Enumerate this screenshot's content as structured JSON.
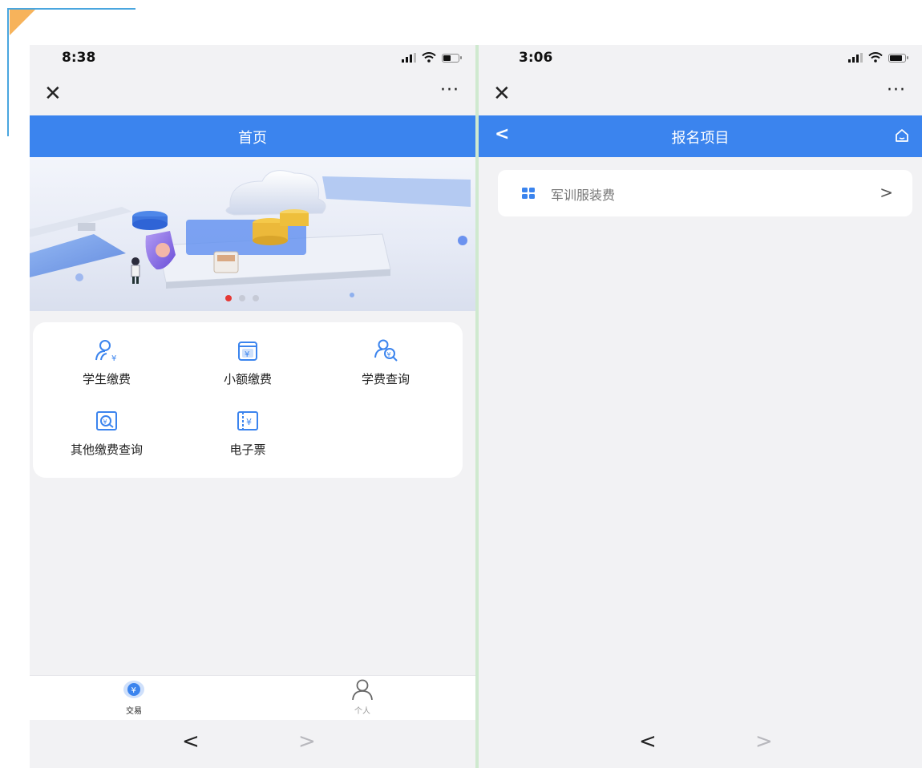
{
  "left_screen": {
    "status": {
      "time": "8:38"
    },
    "nav": {
      "close": "✕",
      "more": "···"
    },
    "header": {
      "title": "首页"
    },
    "carousel": {
      "slides": 3,
      "active_index": 0
    },
    "menu": [
      {
        "label": "学生缴费",
        "icon": "student-payment-icon"
      },
      {
        "label": "小额缴费",
        "icon": "small-payment-icon"
      },
      {
        "label": "学费查询",
        "icon": "tuition-query-icon"
      },
      {
        "label": "其他缴费查询",
        "icon": "other-payment-query-icon"
      },
      {
        "label": "电子票",
        "icon": "e-ticket-icon"
      }
    ],
    "tabbar": [
      {
        "label": "交易",
        "icon": "transaction-icon",
        "active": true
      },
      {
        "label": "个人",
        "icon": "person-icon",
        "active": false
      }
    ],
    "browser_nav": {
      "back": "<",
      "forward": ">"
    }
  },
  "right_screen": {
    "status": {
      "time": "3:06"
    },
    "nav": {
      "close": "✕",
      "more": "···"
    },
    "header": {
      "title": "报名项目",
      "back": "<"
    },
    "items": [
      {
        "label": "军训服装费",
        "icon": "grid-icon"
      }
    ],
    "item_arrow": ">",
    "browser_nav": {
      "back": "<",
      "forward": ">"
    }
  },
  "colors": {
    "primary": "#3b84ee",
    "background": "#f2f2f4",
    "active_dot": "#e53935"
  }
}
